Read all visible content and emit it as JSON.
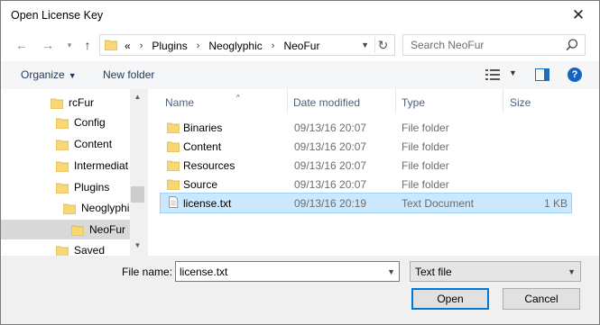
{
  "window": {
    "title": "Open License Key"
  },
  "nav": {
    "breadcrumb_overflow": "«",
    "breadcrumbs": [
      "Plugins",
      "Neoglyphic",
      "NeoFur"
    ],
    "search_placeholder": "Search NeoFur"
  },
  "toolbar": {
    "organize_label": "Organize",
    "new_folder_label": "New folder",
    "help_label": "?"
  },
  "sidebar": {
    "items": [
      {
        "label": "rcFur"
      },
      {
        "label": "Config"
      },
      {
        "label": "Content"
      },
      {
        "label": "Intermediat"
      },
      {
        "label": "Plugins"
      },
      {
        "label": "Neoglyphi"
      },
      {
        "label": "NeoFur"
      },
      {
        "label": "Saved"
      }
    ]
  },
  "columns": {
    "name": "Name",
    "date": "Date modified",
    "type": "Type",
    "size": "Size"
  },
  "files": [
    {
      "name": "Binaries",
      "date": "09/13/16 20:07",
      "type": "File folder",
      "size": "",
      "icon": "folder-icon"
    },
    {
      "name": "Content",
      "date": "09/13/16 20:07",
      "type": "File folder",
      "size": "",
      "icon": "folder-icon"
    },
    {
      "name": "Resources",
      "date": "09/13/16 20:07",
      "type": "File folder",
      "size": "",
      "icon": "folder-icon"
    },
    {
      "name": "Source",
      "date": "09/13/16 20:07",
      "type": "File folder",
      "size": "",
      "icon": "folder-icon"
    },
    {
      "name": "license.txt",
      "date": "09/13/16 20:19",
      "type": "Text Document",
      "size": "1 KB",
      "icon": "text-file-icon"
    }
  ],
  "footer": {
    "file_name_label": "File name:",
    "file_name_value": "license.txt",
    "file_type_value": "Text file",
    "open_label": "Open",
    "cancel_label": "Cancel"
  },
  "colors": {
    "folder": "#f8d775",
    "selection": "#cce8ff",
    "accent": "#0078d7"
  }
}
